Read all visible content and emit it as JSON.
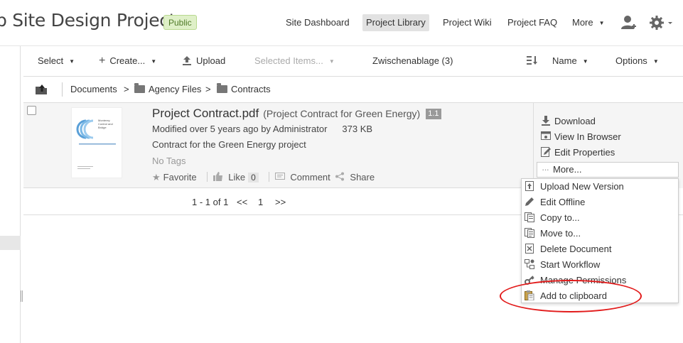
{
  "header": {
    "site_title": "b Site Design Project",
    "visibility_badge": "Public",
    "nav": [
      {
        "label": "Site Dashboard"
      },
      {
        "label": "Project Library"
      },
      {
        "label": "Project Wiki"
      },
      {
        "label": "Project FAQ"
      },
      {
        "label": "More"
      }
    ]
  },
  "toolbar": {
    "select": "Select",
    "create": "Create...",
    "upload": "Upload",
    "selected_items": "Selected Items...",
    "clipboard": "Zwischenablage (3)",
    "sort": "Name",
    "options": "Options"
  },
  "breadcrumb": {
    "root": "Documents",
    "sep": ">",
    "folder1": "Agency Files",
    "folder2": "Contracts"
  },
  "document": {
    "name": "Project Contract.pdf",
    "title": "(Project Contract for Green Energy)",
    "version": "1.1",
    "modified": "Modified over 5 years ago by Administrator",
    "size": "373 KB",
    "description": "Contract for the Green Energy project",
    "tags": "No Tags",
    "favorite": "Favorite",
    "like": "Like",
    "like_count": "0",
    "comment": "Comment",
    "share": "Share",
    "thumb_text": "Monterey Control and Bridge"
  },
  "doc_actions": {
    "download": "Download",
    "view_in_browser": "View In Browser",
    "edit_properties": "Edit Properties",
    "more": "More..."
  },
  "paginator": {
    "range": "1 - 1 of 1",
    "prev": "<<",
    "page": "1",
    "next": ">>"
  },
  "more_menu": {
    "items": [
      {
        "label": "Upload New Version",
        "icon": "upload-version-icon"
      },
      {
        "label": "Edit Offline",
        "icon": "pencil-icon"
      },
      {
        "label": "Copy to...",
        "icon": "copy-icon"
      },
      {
        "label": "Move to...",
        "icon": "move-icon"
      },
      {
        "label": "Delete Document",
        "icon": "delete-icon"
      },
      {
        "label": "Start Workflow",
        "icon": "workflow-icon"
      },
      {
        "label": "Manage Permissions",
        "icon": "key-icon"
      },
      {
        "label": "Add to clipboard",
        "icon": "clipboard-icon"
      }
    ]
  },
  "colors": {
    "highlight": "#e21b1b",
    "badge_bg": "#dff0c8",
    "active_nav_bg": "#e2e2e2"
  }
}
